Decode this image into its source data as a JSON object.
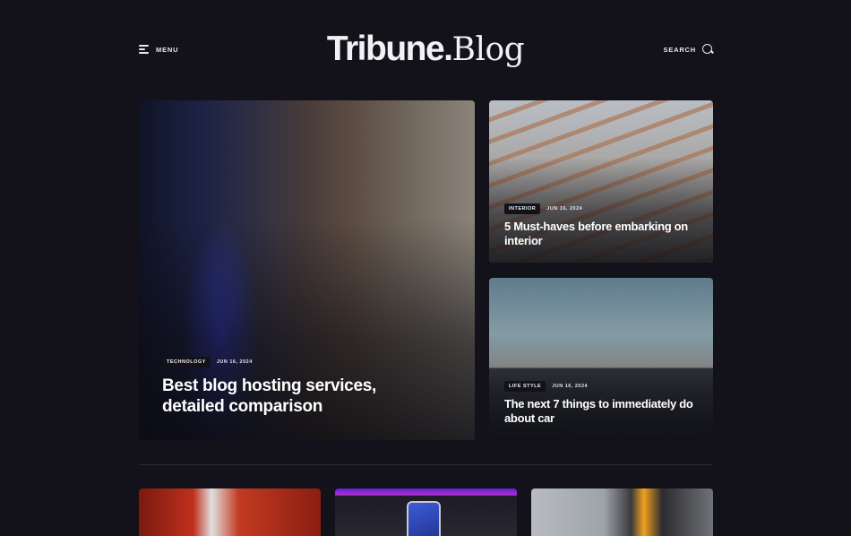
{
  "header": {
    "menu_label": "MENU",
    "logo_part1": "Tribune.",
    "logo_part2": "Blog",
    "search_label": "SEARCH"
  },
  "featured": {
    "tag": "TECHNOLOGY",
    "date": "JUN 16, 2024",
    "title": "Best blog hosting services, detailed comparison"
  },
  "side_posts": [
    {
      "tag": "INTERIOR",
      "date": "JUN 16, 2024",
      "title": "5 Must-haves before embarking on interior"
    },
    {
      "tag": "LIFE STYLE",
      "date": "JUN 16, 2024",
      "title": "The next 7 things to immediately do about car"
    }
  ]
}
